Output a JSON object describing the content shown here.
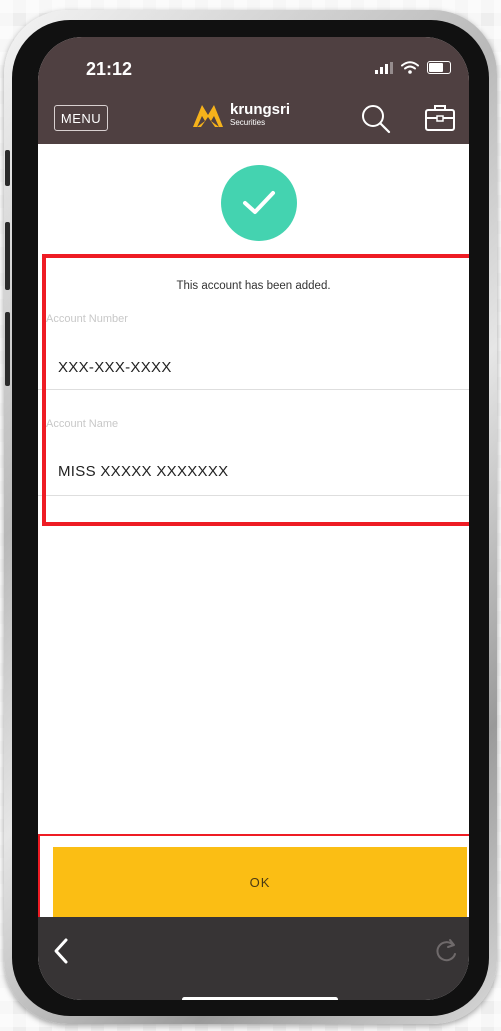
{
  "status_bar": {
    "time": "21:12"
  },
  "header": {
    "menu_label": "MENU",
    "logo_name": "krungsri",
    "logo_sub": "Securities",
    "background": "#4f4041"
  },
  "confirmation": {
    "message": "This account has been added.",
    "account_number_label": "Account Number",
    "account_number_value": "XXX-XXX-XXXX",
    "account_name_label": "Account Name",
    "account_name_value": "MISS XXXXX  XXXXXXX"
  },
  "actions": {
    "ok_label": "OK"
  },
  "colors": {
    "success": "#44d3b0",
    "ok_button": "#fbbe14",
    "highlight": "#ee1c24"
  },
  "icons": {
    "check": "check-icon",
    "search": "search-icon",
    "portfolio": "briefcase-icon",
    "back": "chevron-left-icon",
    "refresh": "refresh-icon"
  }
}
